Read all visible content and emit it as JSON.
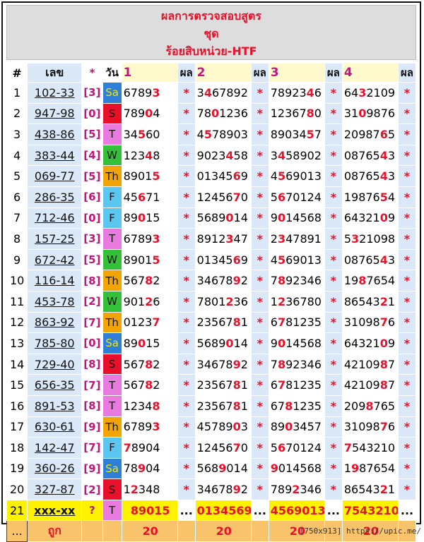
{
  "header": {
    "line1": "ผลการตรวจสอบสูตร",
    "line2": "ชุด",
    "line3": "ร้อยสิบหน่วย-HTF"
  },
  "columns": {
    "hash": "#",
    "num": "เลข",
    "star": "*",
    "day": "วัน",
    "f1": "1",
    "f2": "2",
    "f3": "3",
    "f4": "4",
    "result": "ผล"
  },
  "rows": [
    {
      "idx": "1",
      "num": "102-33",
      "br": "[3]",
      "day": "Sa",
      "v": [
        [
          "6789",
          "3",
          ""
        ],
        [
          "3",
          "4",
          "67892"
        ],
        [
          "78923",
          "4",
          "6"
        ],
        [
          "64",
          "3",
          "2109"
        ]
      ],
      "r": [
        "*",
        "*",
        "*",
        "*"
      ]
    },
    {
      "idx": "2",
      "num": "947-98",
      "br": "[0]",
      "day": "S",
      "v": [
        [
          "789",
          "0",
          "4"
        ],
        [
          "78",
          "0",
          "1236"
        ],
        [
          "12367",
          "8",
          "0"
        ],
        [
          "31",
          "0",
          "9876"
        ]
      ],
      "r": [
        "*",
        "*",
        "*",
        "*"
      ]
    },
    {
      "idx": "3",
      "num": "438-86",
      "br": "[5]",
      "day": "T",
      "v": [
        [
          "34",
          "5",
          "60"
        ],
        [
          "4",
          "5",
          "78903"
        ],
        [
          "89034",
          "5",
          "7"
        ],
        [
          "20987",
          "6",
          "5"
        ]
      ],
      "r": [
        "*",
        "*",
        "*",
        "*"
      ]
    },
    {
      "idx": "4",
      "num": "383-44",
      "br": "[4]",
      "day": "W",
      "v": [
        [
          "123",
          "4",
          "8"
        ],
        [
          "9023",
          "4",
          "58"
        ],
        [
          "3",
          "4",
          "58902"
        ],
        [
          "08765",
          "4",
          "3"
        ]
      ],
      "r": [
        "*",
        "*",
        "*",
        "*"
      ]
    },
    {
      "idx": "5",
      "num": "069-77",
      "br": "[5]",
      "day": "Th",
      "v": [
        [
          "8901",
          "5",
          ""
        ],
        [
          "01345",
          "6",
          "9"
        ],
        [
          "4",
          "5",
          "69013"
        ],
        [
          "08765",
          "4",
          "3"
        ]
      ],
      "r": [
        "*",
        "*",
        "*",
        "*"
      ]
    },
    {
      "idx": "6",
      "num": "286-35",
      "br": "[6]",
      "day": "F",
      "v": [
        [
          "45",
          "6",
          "71"
        ],
        [
          "12456",
          "7",
          "0"
        ],
        [
          "5",
          "6",
          "70124"
        ],
        [
          "19876",
          "5",
          "4"
        ]
      ],
      "r": [
        "*",
        "*",
        "*",
        "*"
      ]
    },
    {
      "idx": "7",
      "num": "712-46",
      "br": "[0]",
      "day": "F",
      "v": [
        [
          "89",
          "0",
          "15"
        ],
        [
          "5689",
          "0",
          "14"
        ],
        [
          "9",
          "0",
          "14568"
        ],
        [
          "64321",
          "0",
          "9"
        ]
      ],
      "r": [
        "*",
        "*",
        "*",
        "*"
      ]
    },
    {
      "idx": "8",
      "num": "157-25",
      "br": "[3]",
      "day": "T",
      "v": [
        [
          "6789",
          "3",
          ""
        ],
        [
          "8912",
          "3",
          "47"
        ],
        [
          "2",
          "3",
          "47891"
        ],
        [
          "5",
          "3",
          "21098"
        ]
      ],
      "r": [
        "*",
        "*",
        "*",
        "*"
      ]
    },
    {
      "idx": "9",
      "num": "672-42",
      "br": "[5]",
      "day": "W",
      "v": [
        [
          "8901",
          "5",
          ""
        ],
        [
          "01345",
          "6",
          "9"
        ],
        [
          "4",
          "5",
          "69013"
        ],
        [
          "08765",
          "4",
          "3"
        ]
      ],
      "r": [
        "*",
        "*",
        "*",
        "*"
      ]
    },
    {
      "idx": "10",
      "num": "116-14",
      "br": "[8]",
      "day": "Th",
      "v": [
        [
          "567",
          "8",
          "2"
        ],
        [
          "34678",
          "9",
          "2"
        ],
        [
          "7",
          "8",
          "92346"
        ],
        [
          "19",
          "8",
          "7654"
        ]
      ],
      "r": [
        "*",
        "*",
        "*",
        "*"
      ]
    },
    {
      "idx": "11",
      "num": "453-78",
      "br": "[2]",
      "day": "W",
      "v": [
        [
          "901",
          "2",
          "6"
        ],
        [
          "7801",
          "2",
          "36"
        ],
        [
          "1",
          "2",
          "36780"
        ],
        [
          "86543",
          "2",
          "1"
        ]
      ],
      "r": [
        "*",
        "*",
        "*",
        "*"
      ]
    },
    {
      "idx": "12",
      "num": "863-92",
      "br": "[7]",
      "day": "Th",
      "v": [
        [
          "0123",
          "7",
          ""
        ],
        [
          "23567",
          "8",
          "1"
        ],
        [
          "6",
          "7",
          "81235"
        ],
        [
          "31098",
          "7",
          "6"
        ]
      ],
      "r": [
        "*",
        "*",
        "*",
        "*"
      ]
    },
    {
      "idx": "13",
      "num": "785-80",
      "br": "[0]",
      "day": "Sa",
      "v": [
        [
          "89",
          "0",
          "15"
        ],
        [
          "5689",
          "0",
          "14"
        ],
        [
          "9",
          "0",
          "14568"
        ],
        [
          "64321",
          "0",
          "9"
        ]
      ],
      "r": [
        "*",
        "*",
        "*",
        "*"
      ]
    },
    {
      "idx": "14",
      "num": "729-40",
      "br": "[8]",
      "day": "S",
      "v": [
        [
          "567",
          "8",
          "2"
        ],
        [
          "34678",
          "9",
          "2"
        ],
        [
          "7",
          "8",
          "92346"
        ],
        [
          "42109",
          "8",
          "7"
        ]
      ],
      "r": [
        "*",
        "*",
        "*",
        "*"
      ]
    },
    {
      "idx": "15",
      "num": "656-35",
      "br": "[7]",
      "day": "T",
      "v": [
        [
          "567",
          "8",
          "2"
        ],
        [
          "23567",
          "8",
          "1"
        ],
        [
          "6",
          "7",
          "81235"
        ],
        [
          "42109",
          "8",
          "7"
        ]
      ],
      "r": [
        "*",
        "*",
        "*",
        "*"
      ]
    },
    {
      "idx": "16",
      "num": "891-53",
      "br": "[8]",
      "day": "T",
      "v": [
        [
          "1234",
          "8",
          ""
        ],
        [
          "23567",
          "8",
          "1"
        ],
        [
          "67",
          "8",
          "1235"
        ],
        [
          "209",
          "8",
          "765"
        ]
      ],
      "r": [
        "*",
        "*",
        "*",
        "*"
      ]
    },
    {
      "idx": "17",
      "num": "630-61",
      "br": "[9]",
      "day": "Th",
      "v": [
        [
          "6789",
          "3",
          ""
        ],
        [
          "45789",
          "0",
          "3"
        ],
        [
          "89",
          "0",
          "3457"
        ],
        [
          "31098",
          "7",
          "6"
        ]
      ],
      "r": [
        "*",
        "*",
        "*",
        "*"
      ]
    },
    {
      "idx": "18",
      "num": "142-47",
      "br": "[7]",
      "day": "F",
      "v": [
        [
          "",
          "7",
          "8904"
        ],
        [
          "12456",
          "7",
          "0"
        ],
        [
          "5",
          "6",
          "70124"
        ],
        [
          "",
          "7",
          "543210"
        ]
      ],
      "r": [
        "*",
        "*",
        "*",
        "*"
      ]
    },
    {
      "idx": "19",
      "num": "360-26",
      "br": "[9]",
      "day": "Sa",
      "v": [
        [
          "78",
          "9",
          "04"
        ],
        [
          "568",
          "9",
          "014"
        ],
        [
          "",
          "9",
          "014568"
        ],
        [
          "1",
          "9",
          "87654"
        ]
      ],
      "r": [
        "*",
        "*",
        "*",
        "*"
      ]
    },
    {
      "idx": "20",
      "num": "327-87",
      "br": "[2]",
      "day": "S",
      "v": [
        [
          "1",
          "2",
          "348"
        ],
        [
          "34678",
          "9",
          "2"
        ],
        [
          "789",
          "2",
          "346"
        ],
        [
          "86543",
          "2",
          "1"
        ]
      ],
      "r": [
        "*",
        "*",
        "*",
        "*"
      ]
    }
  ],
  "prediction": {
    "idx": "21",
    "num": "xxx-xx",
    "br": "?",
    "day": "T",
    "v": [
      "89015",
      "0134569",
      "4569013",
      "7543210"
    ],
    "r": "..."
  },
  "summary": {
    "idx": "...",
    "label": "ถูก",
    "totals": [
      "20",
      "20",
      "20",
      "20"
    ]
  },
  "footer_text": "[750x913] https://upic.me/",
  "colors": {
    "accent": "#e8102a",
    "bracket": "#c01580",
    "row_bg": "#dbe8f7",
    "prediction_bg": "#fff200",
    "summary_bg": "#f9c36b"
  }
}
